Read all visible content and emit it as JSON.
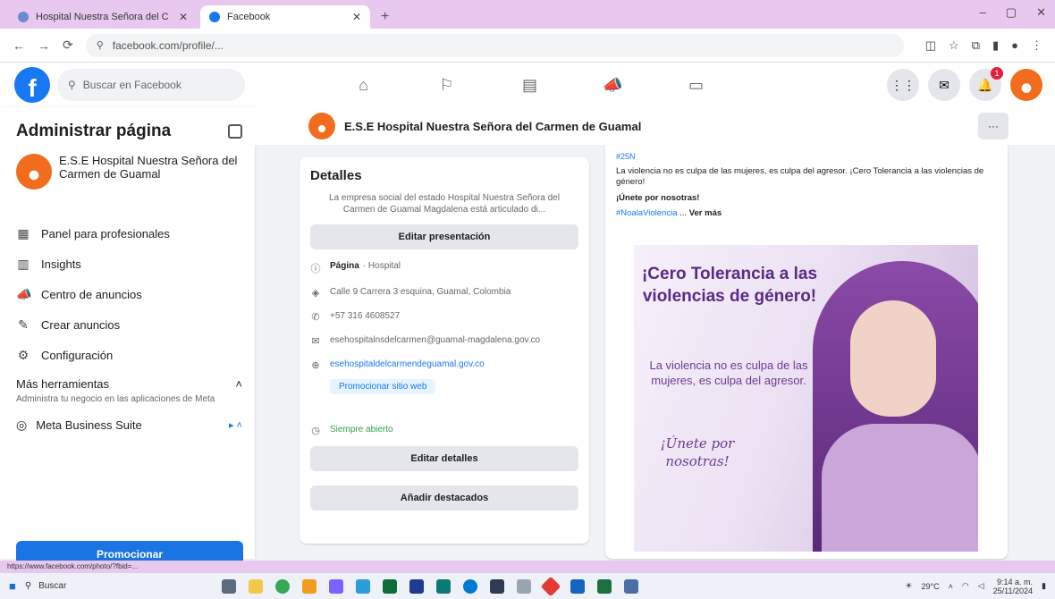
{
  "browser": {
    "tabs": [
      {
        "title": "Hospital Nuestra Señora del C"
      },
      {
        "title": "Facebook"
      }
    ],
    "new_tab": "+",
    "url": "facebook.com/profile/...",
    "window_controls": [
      "–",
      "▢",
      "✕"
    ]
  },
  "fb_nav": {
    "logo": "f",
    "search_placeholder": "Buscar en Facebook",
    "notification_count": "1"
  },
  "sidebar": {
    "title": "Administrar página",
    "page_name": "E.S.E Hospital Nuestra Señora del Carmen de Guamal",
    "items": [
      {
        "label": "Panel para profesionales"
      },
      {
        "label": "Insights"
      },
      {
        "label": "Centro de anuncios"
      },
      {
        "label": "Crear anuncios"
      },
      {
        "label": "Configuración"
      }
    ],
    "more_tools": "Más herramientas",
    "more_tools_desc": "Administra tu negocio en las aplicaciones de Meta",
    "meta_suite": "Meta Business Suite",
    "promote": "Promocionar"
  },
  "page_header": {
    "name": "E.S.E Hospital Nuestra Señora del Carmen de Guamal",
    "more": "···"
  },
  "details": {
    "title": "Detalles",
    "description": "La empresa social del estado Hospital Nuestra Señora del Carmen de Guamal Magdalena está articulado di...",
    "edit_presentation": "Editar presentación",
    "page_label": "Página",
    "page_category": "· Hospital",
    "address": "Calle 9 Carrera 3 esquina, Guamal, Colombia",
    "phone": "+57 316 4608527",
    "email": "esehospitalnsdelcarmen@guamal-magdalena.gov.co",
    "website": "esehospitaldelcarmendeguamal.gov.co",
    "promote_website": "Promocionar sitio web",
    "hours": "Siempre abierto",
    "edit_details": "Editar detalles",
    "add_featured": "Añadir destacados"
  },
  "post": {
    "tag": "#25N",
    "text": "La violencia no es culpa de las mujeres, es culpa del agresor. ¡Cero Tolerancia a las violencias de género!",
    "bold_line": "¡Únete por nosotras!",
    "hashtag": "#NoalaViolencia",
    "see_more": "Ver más",
    "image_headline": "¡Cero Tolerancia a las violencias de género!",
    "image_body": "La violencia no es culpa de las mujeres, es culpa del agresor.",
    "image_call": "¡Únete por nosotras!"
  },
  "statusbar": {
    "link": "https://www.facebook.com/photo/?fbid=... "
  },
  "taskbar": {
    "search": "Buscar",
    "weather": "29°C",
    "time": "9:14 a. m.",
    "date": "25/11/2024"
  },
  "colors": {
    "fb_blue": "#1877f2",
    "brand_orange": "#f26c1d",
    "browser_tint": "#e9c8ef"
  }
}
